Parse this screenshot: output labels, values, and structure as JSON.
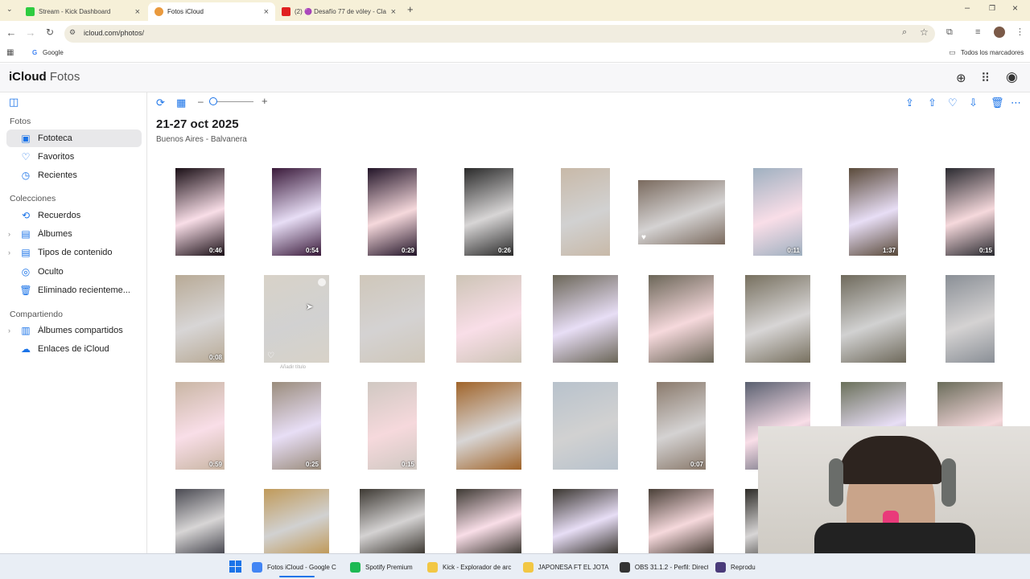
{
  "browser": {
    "tabs": [
      {
        "title": "Stream - Kick Dashboard",
        "favicon_color": "#2ecc40"
      },
      {
        "title": "Fotos iCloud",
        "favicon_color": "#ea9a3e"
      },
      {
        "title": "(2) 🟣 Desafío 77 de vóley - Cla",
        "favicon_color": "#e02020"
      }
    ],
    "new_tab_label": "+",
    "url": "icloud.com/photos/",
    "bookmarks": {
      "google": "Google",
      "all_bookmarks": "Todos los marcadores"
    }
  },
  "app": {
    "brand": "iCloud",
    "brand_sub": "Fotos"
  },
  "sidebar": {
    "sections": [
      {
        "title": "Fotos",
        "items": [
          {
            "label": "Fototeca",
            "icon": "photo-library-icon",
            "selected": true
          },
          {
            "label": "Favoritos",
            "icon": "heart-icon"
          },
          {
            "label": "Recientes",
            "icon": "clock-icon"
          }
        ]
      },
      {
        "title": "Colecciones",
        "items": [
          {
            "label": "Recuerdos",
            "icon": "memories-icon"
          },
          {
            "label": "Álbumes",
            "icon": "albums-icon",
            "expandable": true
          },
          {
            "label": "Tipos de contenido",
            "icon": "media-types-icon",
            "expandable": true
          },
          {
            "label": "Oculto",
            "icon": "eye-slash-icon"
          },
          {
            "label": "Eliminado recienteme...",
            "icon": "trash-icon"
          }
        ]
      },
      {
        "title": "Compartiendo",
        "items": [
          {
            "label": "Álbumes compartidos",
            "icon": "shared-albums-icon",
            "expandable": true
          },
          {
            "label": "Enlaces de iCloud",
            "icon": "cloud-link-icon"
          }
        ]
      }
    ]
  },
  "main": {
    "date_title": "21-27 oct 2025",
    "location": "Buenos Aires - Balvanera",
    "hover_caption": "Añadir título",
    "rows": [
      [
        {
          "duration": "0:46"
        },
        {
          "duration": "0:54"
        },
        {
          "duration": "0:29"
        },
        {
          "duration": "0:26"
        },
        {
          "duration": ""
        },
        {
          "duration": "",
          "favorite": true
        },
        {
          "duration": "0:11"
        },
        {
          "duration": "1:37"
        },
        {
          "duration": "0:15"
        }
      ],
      [
        {
          "duration": "0:08"
        },
        {
          "duration": "",
          "favorite_outline": true
        },
        {
          "duration": ""
        },
        {
          "duration": ""
        },
        {
          "duration": ""
        },
        {
          "duration": ""
        },
        {
          "duration": ""
        },
        {
          "duration": ""
        },
        {
          "duration": ""
        }
      ],
      [
        {
          "duration": "0:59"
        },
        {
          "duration": "0:25"
        },
        {
          "duration": "0:15"
        },
        {
          "duration": ""
        },
        {
          "duration": ""
        },
        {
          "duration": "0:07"
        },
        {
          "duration": ""
        },
        {
          "duration": ""
        },
        {
          "duration": ""
        }
      ],
      [
        {
          "duration": ""
        },
        {
          "duration": ""
        },
        {
          "duration": ""
        },
        {
          "duration": ""
        },
        {
          "duration": ""
        },
        {
          "duration": ""
        },
        {
          "duration": ""
        },
        {
          "duration": ""
        },
        {
          "duration": ""
        }
      ]
    ]
  },
  "taskbar": {
    "items": [
      {
        "label": "Fotos iCloud - Google C",
        "color": "#4285f4",
        "active": true
      },
      {
        "label": "Spotify Premium",
        "color": "#1db954"
      },
      {
        "label": "Kick - Explorador de arc",
        "color": "#f2c744"
      },
      {
        "label": "JAPONESA FT EL JOTA -",
        "color": "#f2c744"
      },
      {
        "label": "OBS 31.1.2 - Perfil: Direct",
        "color": "#333333"
      },
      {
        "label": "Reprodu",
        "color": "#4a3b7a"
      }
    ]
  },
  "colors": {
    "accent": "#1a73e8"
  }
}
